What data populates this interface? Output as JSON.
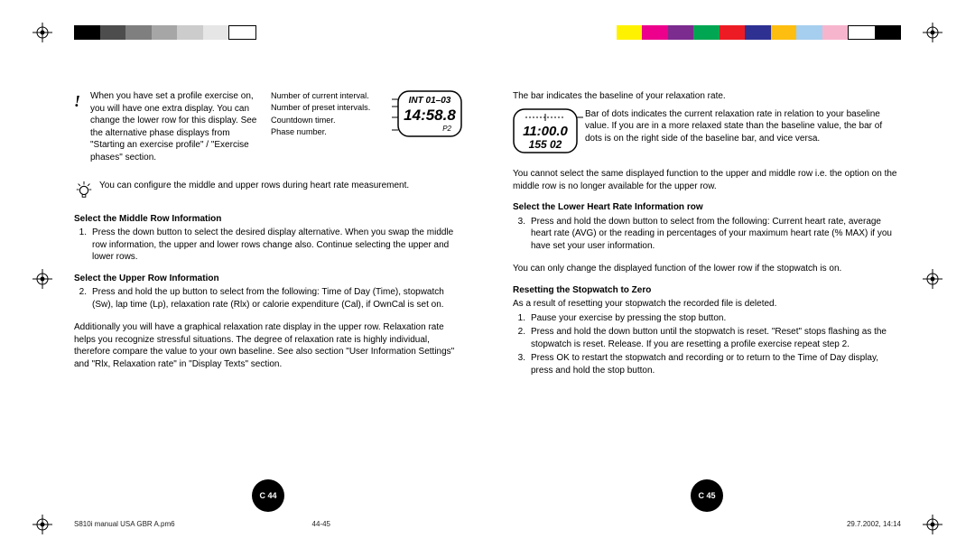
{
  "colorbar": {
    "left": [
      "#000000",
      "#4d4d4d",
      "#7f7f7f",
      "#a6a6a6",
      "#cccccc",
      "#e6e6e6",
      "#ffffff"
    ],
    "right": [
      "#FFF200",
      "#EC008C",
      "#7B2C8E",
      "#00A651",
      "#ED1C24",
      "#2E3192",
      "#FDBE10",
      "#A6CE39",
      "#9E1F63",
      "#FFFFFF",
      "#000000"
    ]
  },
  "left_page": {
    "note_icon": "!",
    "note_text": "When you have set a profile exercise on, you will have one extra display. You can change the lower row for this display. See the alternative phase displays from \"Starting an exercise profile\" / \"Exercise phases\" section.",
    "legend": {
      "l1": "Number of current interval.",
      "l2": "Number of preset intervals.",
      "l3": "Countdown timer.",
      "l4": "Phase number."
    },
    "lcd": {
      "line1": "INT 01–03",
      "line2": "14:58.8",
      "line3": "P2"
    },
    "bulb_text": "You can configure the middle and upper rows during heart rate measurement.",
    "h1": "Select the Middle Row Information",
    "p1_num": "1.",
    "p1": "Press the down button to select the desired display alternative. When you swap the middle row information, the upper and lower rows change also. Continue selecting the upper and lower rows.",
    "h2": "Select the Upper Row Information",
    "p2_num": "2.",
    "p2": "Press and hold the up button to select from the following: Time of Day (Time), stopwatch (Sw), lap time (Lp), relaxation rate (Rlx) or calorie expenditure (Cal), if OwnCal is set on.",
    "p3": "Additionally you will have a graphical relaxation rate display in the upper row. Relaxation rate helps you recognize stressful situations. The degree of relaxation rate is highly individual, therefore compare the value to your own baseline. See also section \"User Information Settings\" and \"Rlx, Relaxation rate\" in \"Display Texts\" section.",
    "pagenum": "C 44"
  },
  "right_page": {
    "top_line": "The bar indicates the baseline of your relaxation rate.",
    "lcd": {
      "line1": "11:00.0",
      "line2": "155 02"
    },
    "top_para": "Bar of dots indicates the current relaxation rate in relation to your baseline value. If you are in a more relaxed state than the baseline value, the bar of dots is on the right side of the baseline bar, and vice versa.",
    "p_unique": "You cannot select the same displayed function to the upper and middle row i.e. the option on the middle row is no longer available for the upper row.",
    "h1": "Select the Lower Heart Rate Information row",
    "p1_num": "3.",
    "p1": "Press and hold the down button to select from the following: Current heart rate, average heart rate (AVG) or the reading in percentages of your maximum heart rate (% MAX) if you have set your user information.",
    "p2": "You can only change the displayed function of the lower row if the stopwatch is on.",
    "h2": "Resetting the Stopwatch to Zero",
    "p3": "As a result of resetting your stopwatch the recorded file is deleted.",
    "li1_num": "1.",
    "li1": "Pause your exercise by pressing the stop button.",
    "li2_num": "2.",
    "li2": "Press and hold the down button until the stopwatch is reset. \"Reset\" stops flashing as the stopwatch is reset. Release. If you are resetting a profile exercise repeat step 2.",
    "li3_num": "3.",
    "li3": "Press OK to restart the stopwatch and recording or to return to the Time of Day display, press and hold the stop button.",
    "pagenum": "C 45"
  },
  "footer": {
    "file": "S810i manual USA GBR A.pm6",
    "pages": "44-45",
    "timestamp": "29.7.2002, 14:14"
  }
}
